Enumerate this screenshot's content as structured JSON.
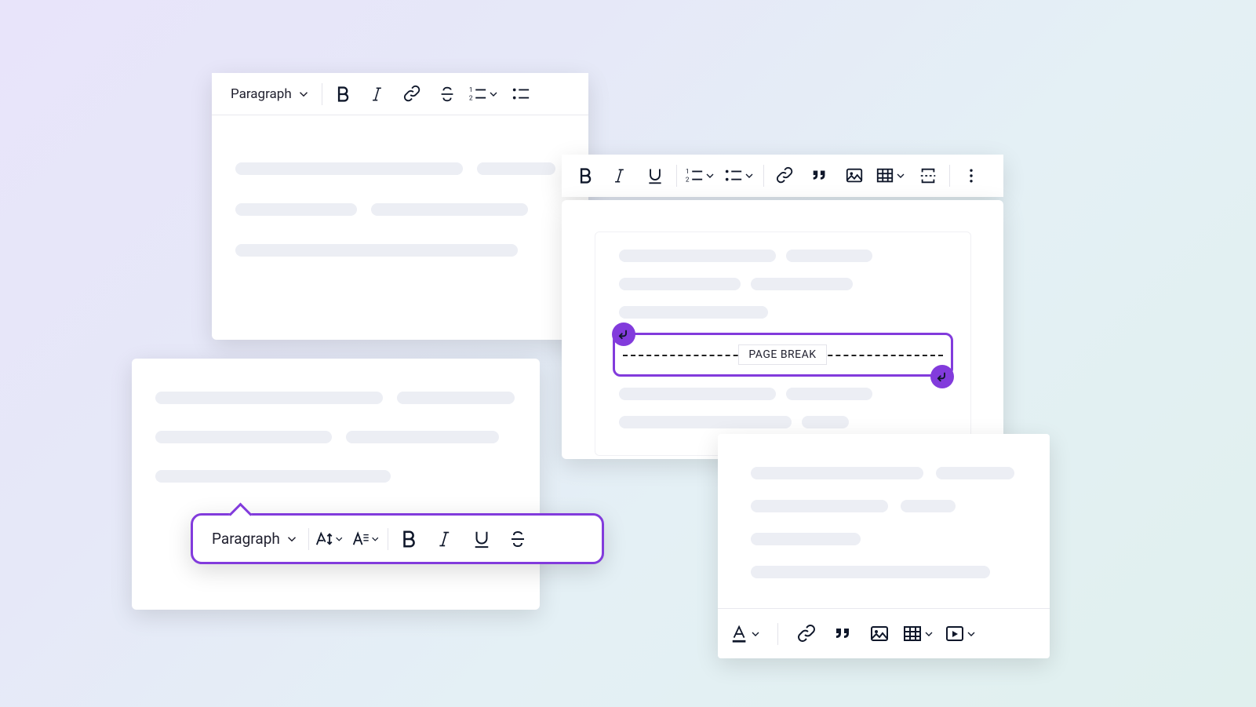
{
  "panelA": {
    "style_selector": {
      "label": "Paragraph"
    }
  },
  "panelB": {
    "page_break_label": "PAGE BREAK"
  },
  "panelC": {
    "balloon": {
      "style_selector": {
        "label": "Paragraph"
      }
    }
  },
  "icons": {
    "bold": "bold-icon",
    "italic": "italic-icon",
    "underline": "underline-icon",
    "link": "link-icon",
    "strikethrough": "strikethrough-icon",
    "ordered_list": "ordered-list-icon",
    "unordered_list": "unordered-list-icon",
    "quote": "quote-icon",
    "image": "image-icon",
    "table": "table-icon",
    "page_break": "page-break-icon",
    "font_size": "font-size-icon",
    "font_family": "font-family-icon",
    "font_color": "font-color-icon",
    "media": "media-icon",
    "more": "more-icon",
    "chevron": "chevron-down-icon"
  },
  "colors": {
    "accent": "#823bdc",
    "text": "#0f172a"
  }
}
